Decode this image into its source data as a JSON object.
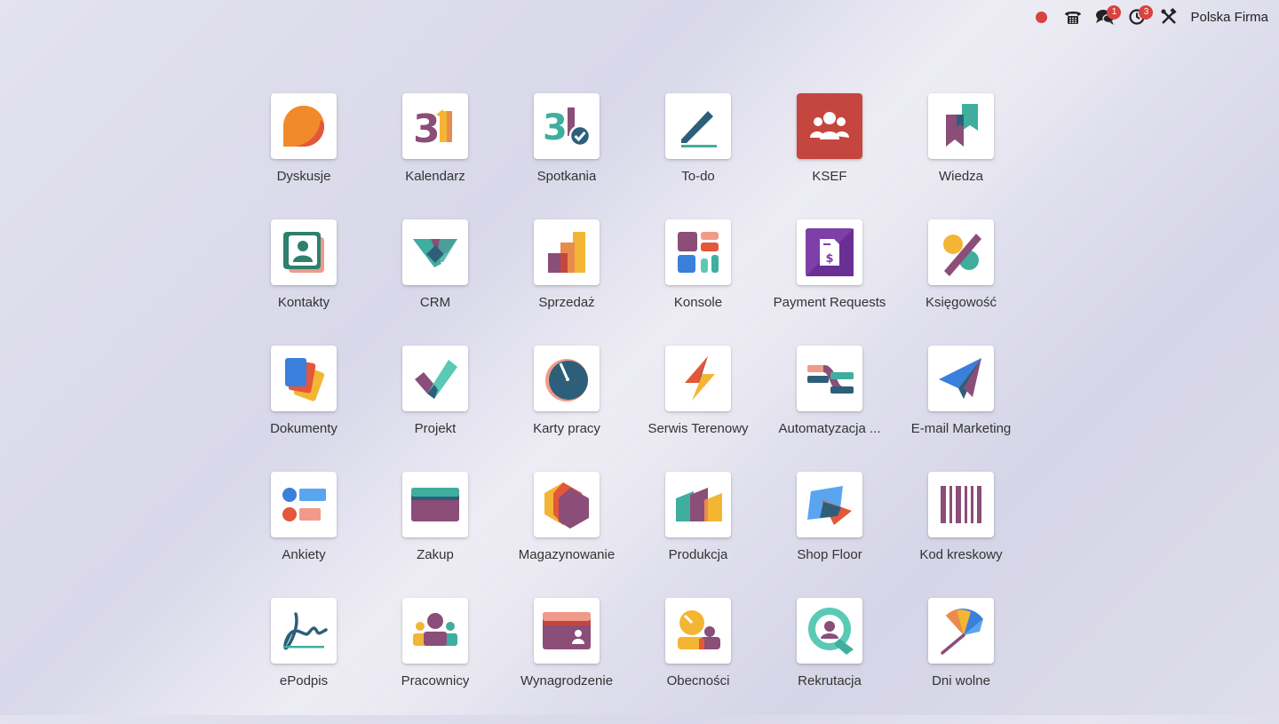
{
  "topbar": {
    "record_indicator_color": "#d9433f",
    "phone_icon": "phone-icon",
    "messages_badge": "1",
    "activities_badge": "3",
    "debug_icon": "tools-icon",
    "company_name": "Polska Firma"
  },
  "apps": [
    {
      "label": "Dyskusje",
      "icon": "discuss-icon"
    },
    {
      "label": "Kalendarz",
      "icon": "calendar-icon"
    },
    {
      "label": "Spotkania",
      "icon": "appointments-icon"
    },
    {
      "label": "To-do",
      "icon": "todo-icon"
    },
    {
      "label": "KSEF",
      "icon": "ksef-icon"
    },
    {
      "label": "Wiedza",
      "icon": "knowledge-icon"
    },
    {
      "label": "Kontakty",
      "icon": "contacts-icon"
    },
    {
      "label": "CRM",
      "icon": "crm-icon"
    },
    {
      "label": "Sprzedaż",
      "icon": "sales-icon"
    },
    {
      "label": "Konsole",
      "icon": "dashboards-icon"
    },
    {
      "label": "Payment Requests",
      "icon": "payment-requests-icon"
    },
    {
      "label": "Księgowość",
      "icon": "accounting-icon"
    },
    {
      "label": "Dokumenty",
      "icon": "documents-icon"
    },
    {
      "label": "Projekt",
      "icon": "project-icon"
    },
    {
      "label": "Karty pracy",
      "icon": "timesheets-icon"
    },
    {
      "label": "Serwis Terenowy",
      "icon": "field-service-icon"
    },
    {
      "label": "Automatyzacja ...",
      "icon": "automation-icon"
    },
    {
      "label": "E-mail Marketing",
      "icon": "email-marketing-icon"
    },
    {
      "label": "Ankiety",
      "icon": "surveys-icon"
    },
    {
      "label": "Zakup",
      "icon": "purchase-icon"
    },
    {
      "label": "Magazynowanie",
      "icon": "inventory-icon"
    },
    {
      "label": "Produkcja",
      "icon": "manufacturing-icon"
    },
    {
      "label": "Shop Floor",
      "icon": "shop-floor-icon"
    },
    {
      "label": "Kod kreskowy",
      "icon": "barcode-icon"
    },
    {
      "label": "ePodpis",
      "icon": "sign-icon"
    },
    {
      "label": "Pracownicy",
      "icon": "employees-icon"
    },
    {
      "label": "Wynagrodzenie",
      "icon": "payroll-icon"
    },
    {
      "label": "Obecności",
      "icon": "attendances-icon"
    },
    {
      "label": "Rekrutacja",
      "icon": "recruitment-icon"
    },
    {
      "label": "Dni wolne",
      "icon": "time-off-icon"
    }
  ]
}
